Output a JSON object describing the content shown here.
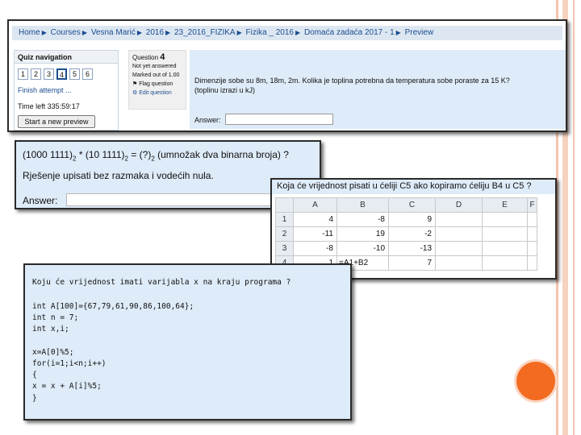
{
  "moodle": {
    "breadcrumbs": [
      "Home",
      "Courses",
      "Vesna Marić",
      "2016",
      "23_2016_FIZIKA",
      "Fizika _ 2016",
      "Domaća zadaća 2017 - 1",
      "Preview"
    ],
    "nav_title": "Quiz navigation",
    "question_numbers": [
      "1",
      "2",
      "3",
      "4",
      "5",
      "6"
    ],
    "current_question": "4",
    "finish_attempt": "Finish attempt ...",
    "time_left": "Time left 335:59:17",
    "start_preview": "Start a new preview",
    "question_label": "Question",
    "question_number": "4",
    "not_answered": "Not yet answered",
    "marked_out_of": "Marked out of 1.00",
    "flag_question": "Flag question",
    "edit_question": "Edit question",
    "question_text_1": "Dimenzije sobe su 8m, 18m, 2m. Kolika je toplina potrebna da temperatura sobe poraste za 15 K?",
    "question_text_2": "(toplinu izrazi u kJ)",
    "answer_label": "Answer:"
  },
  "binary": {
    "term1": "(1000 1111)",
    "times": " * ",
    "term2": "(10 1111)",
    "equals": " = (?)",
    "suffix": " (umnožak dva binarna broja) ?",
    "base": "2",
    "hint": "Rješenje upisati bez razmaka i vodećih nula.",
    "answer_label": "Answer:"
  },
  "excel": {
    "question": "Koja će vrijednost pisati u ćeliji C5 ako kopiramo ćeliju B4 u C5 ?",
    "columns": [
      "A",
      "B",
      "C",
      "D",
      "E",
      "F"
    ],
    "rows": [
      {
        "n": "1",
        "a": "4",
        "b": "-8",
        "c": "9"
      },
      {
        "n": "2",
        "a": "-11",
        "b": "19",
        "c": "-2"
      },
      {
        "n": "3",
        "a": "-8",
        "b": "-10",
        "c": "-13"
      },
      {
        "n": "4",
        "a": "1",
        "b": "=A1+B2",
        "c": "7"
      }
    ]
  },
  "code": {
    "question": "Koju će vrijednost imati varijabla x na kraju programa ?",
    "lines": [
      "int A[100]={67,79,61,90,86,100,64};",
      "int n = 7;",
      "int x,i;",
      "",
      "x=A[0]%5;",
      "for(i=1;i<n;i++)",
      "{",
      "x = x + A[i]%5;",
      "}"
    ]
  },
  "colors": {
    "question_bg": "#deebf8",
    "accent_orange": "#f26b21",
    "link_blue": "#1a4d8f"
  }
}
